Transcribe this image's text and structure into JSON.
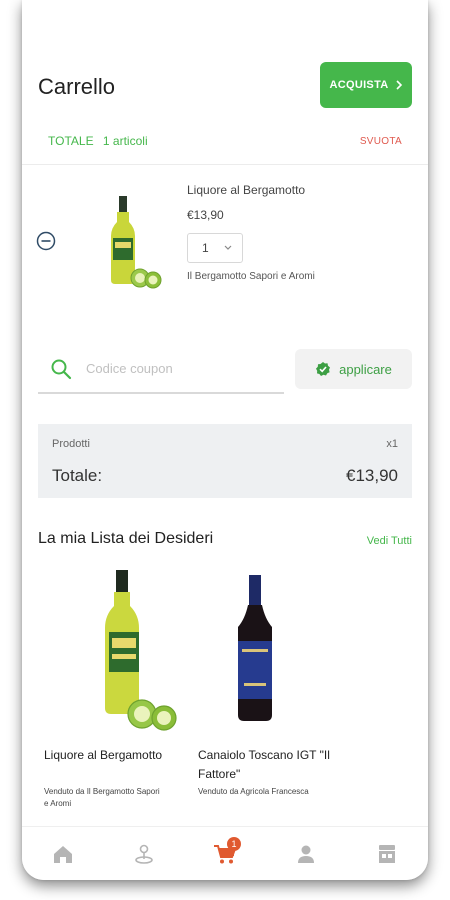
{
  "header": {
    "title": "Carrello",
    "buy_label": "ACQUISTA",
    "total_label": "TOTALE",
    "item_count": "1 articoli",
    "empty_label": "SVUOTA"
  },
  "cart_item": {
    "name": "Liquore al Bergamotto",
    "price": "€13,90",
    "quantity": "1",
    "seller": "Il Bergamotto Sapori e Aromi"
  },
  "coupon": {
    "placeholder": "Codice coupon",
    "apply_label": "applicare"
  },
  "summary": {
    "products_label": "Prodotti",
    "products_qty": "x1",
    "total_label": "Totale:",
    "total_value": "€13,90"
  },
  "wishlist": {
    "title": "La mia Lista dei Desideri",
    "see_all": "Vedi Tutti",
    "items": [
      {
        "name": "Liquore al Bergamotto",
        "seller": "Venduto da Il Bergamotto Sapori e Aromi"
      },
      {
        "name": "Canaiolo Toscano IGT \"Il Fattore\"",
        "seller": "Venduto da Agricola Francesca"
      }
    ]
  },
  "tabbar": {
    "cart_badge": "1",
    "tabs": [
      "home-icon",
      "map-pin-icon",
      "cart-icon",
      "user-icon",
      "store-icon"
    ]
  },
  "colors": {
    "accent_green": "#45b74b",
    "danger_red": "#e05a4f",
    "cart_orange": "#e05a30"
  }
}
